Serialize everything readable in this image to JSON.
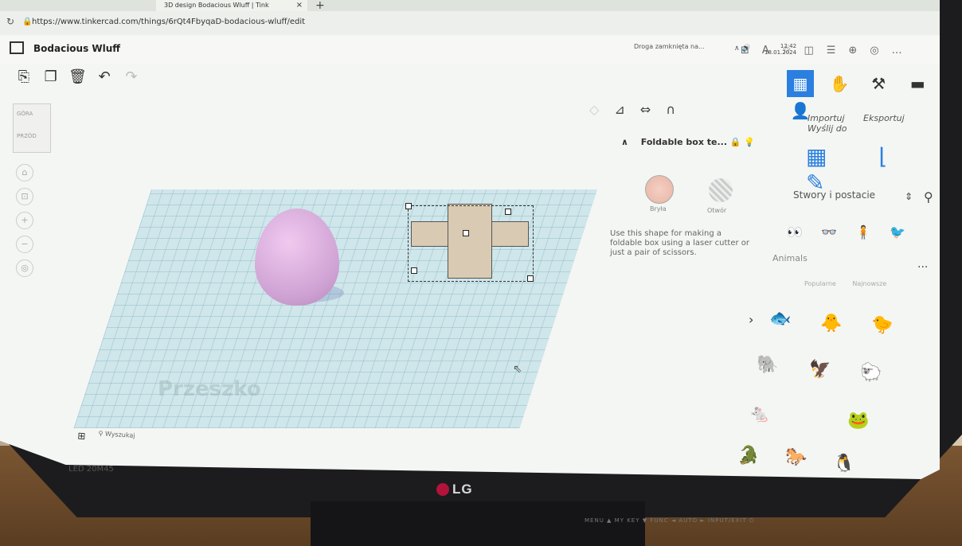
{
  "browser": {
    "url": "https://www.tinkercad.com/things/6rQt4FbyqaD-bodacious-wluff/edit",
    "tab_title": "3D design Bodacious Wluff | Tink",
    "tab_close": "×",
    "new_tab": "+",
    "icons": [
      "reader-mode-icon",
      "read-aloud-icon",
      "favorite-icon",
      "split-screen-icon",
      "favorites-icon",
      "collections-icon",
      "extensions-icon",
      "more-icon"
    ]
  },
  "app": {
    "title": "Bodacious Wluff",
    "toolbar": [
      "copy",
      "paste",
      "duplicate",
      "delete",
      "undo",
      "redo"
    ],
    "modes": [
      "grid-view",
      "bricks",
      "tools",
      "blocks",
      "add-user"
    ],
    "view_cube": {
      "top": "GÓRA",
      "front": "PRZÓD"
    },
    "zoom_controls": [
      "home",
      "fit",
      "+",
      "-",
      "ortho"
    ],
    "actions_top": {
      "import": "Importuj",
      "export": "Eksportuj",
      "share": "Wyślij do"
    }
  },
  "inspector": {
    "title": "Foldable box te...",
    "solid_label": "Bryła",
    "hole_label": "Otwór",
    "description": "Use this shape for making a foldable box using a laser cutter or just a pair of scissors."
  },
  "library": {
    "category": "Stwory i postacie",
    "subcategory": "Animals",
    "sort": [
      "Popularne",
      "Najnowsze"
    ],
    "more": "..."
  },
  "workplane": {
    "watermark": "Przeszko"
  },
  "taskbar": {
    "search": "Wyszukaj",
    "notification": "Droga zamknięta na...",
    "time": "12:42",
    "date": "18.01.2024"
  },
  "monitor": {
    "brand": "LG",
    "model": "LED 20M45",
    "buttons": "MENU  ▲  MY KEY ▼  FUNC ◄  AUTO ►  INPUT/EXIT  ⏻"
  },
  "colors": {
    "accent": "#2a7fe0",
    "egg": "#cda0d2",
    "workplane": "#cfe6ea",
    "box": "#d9cbb3"
  }
}
